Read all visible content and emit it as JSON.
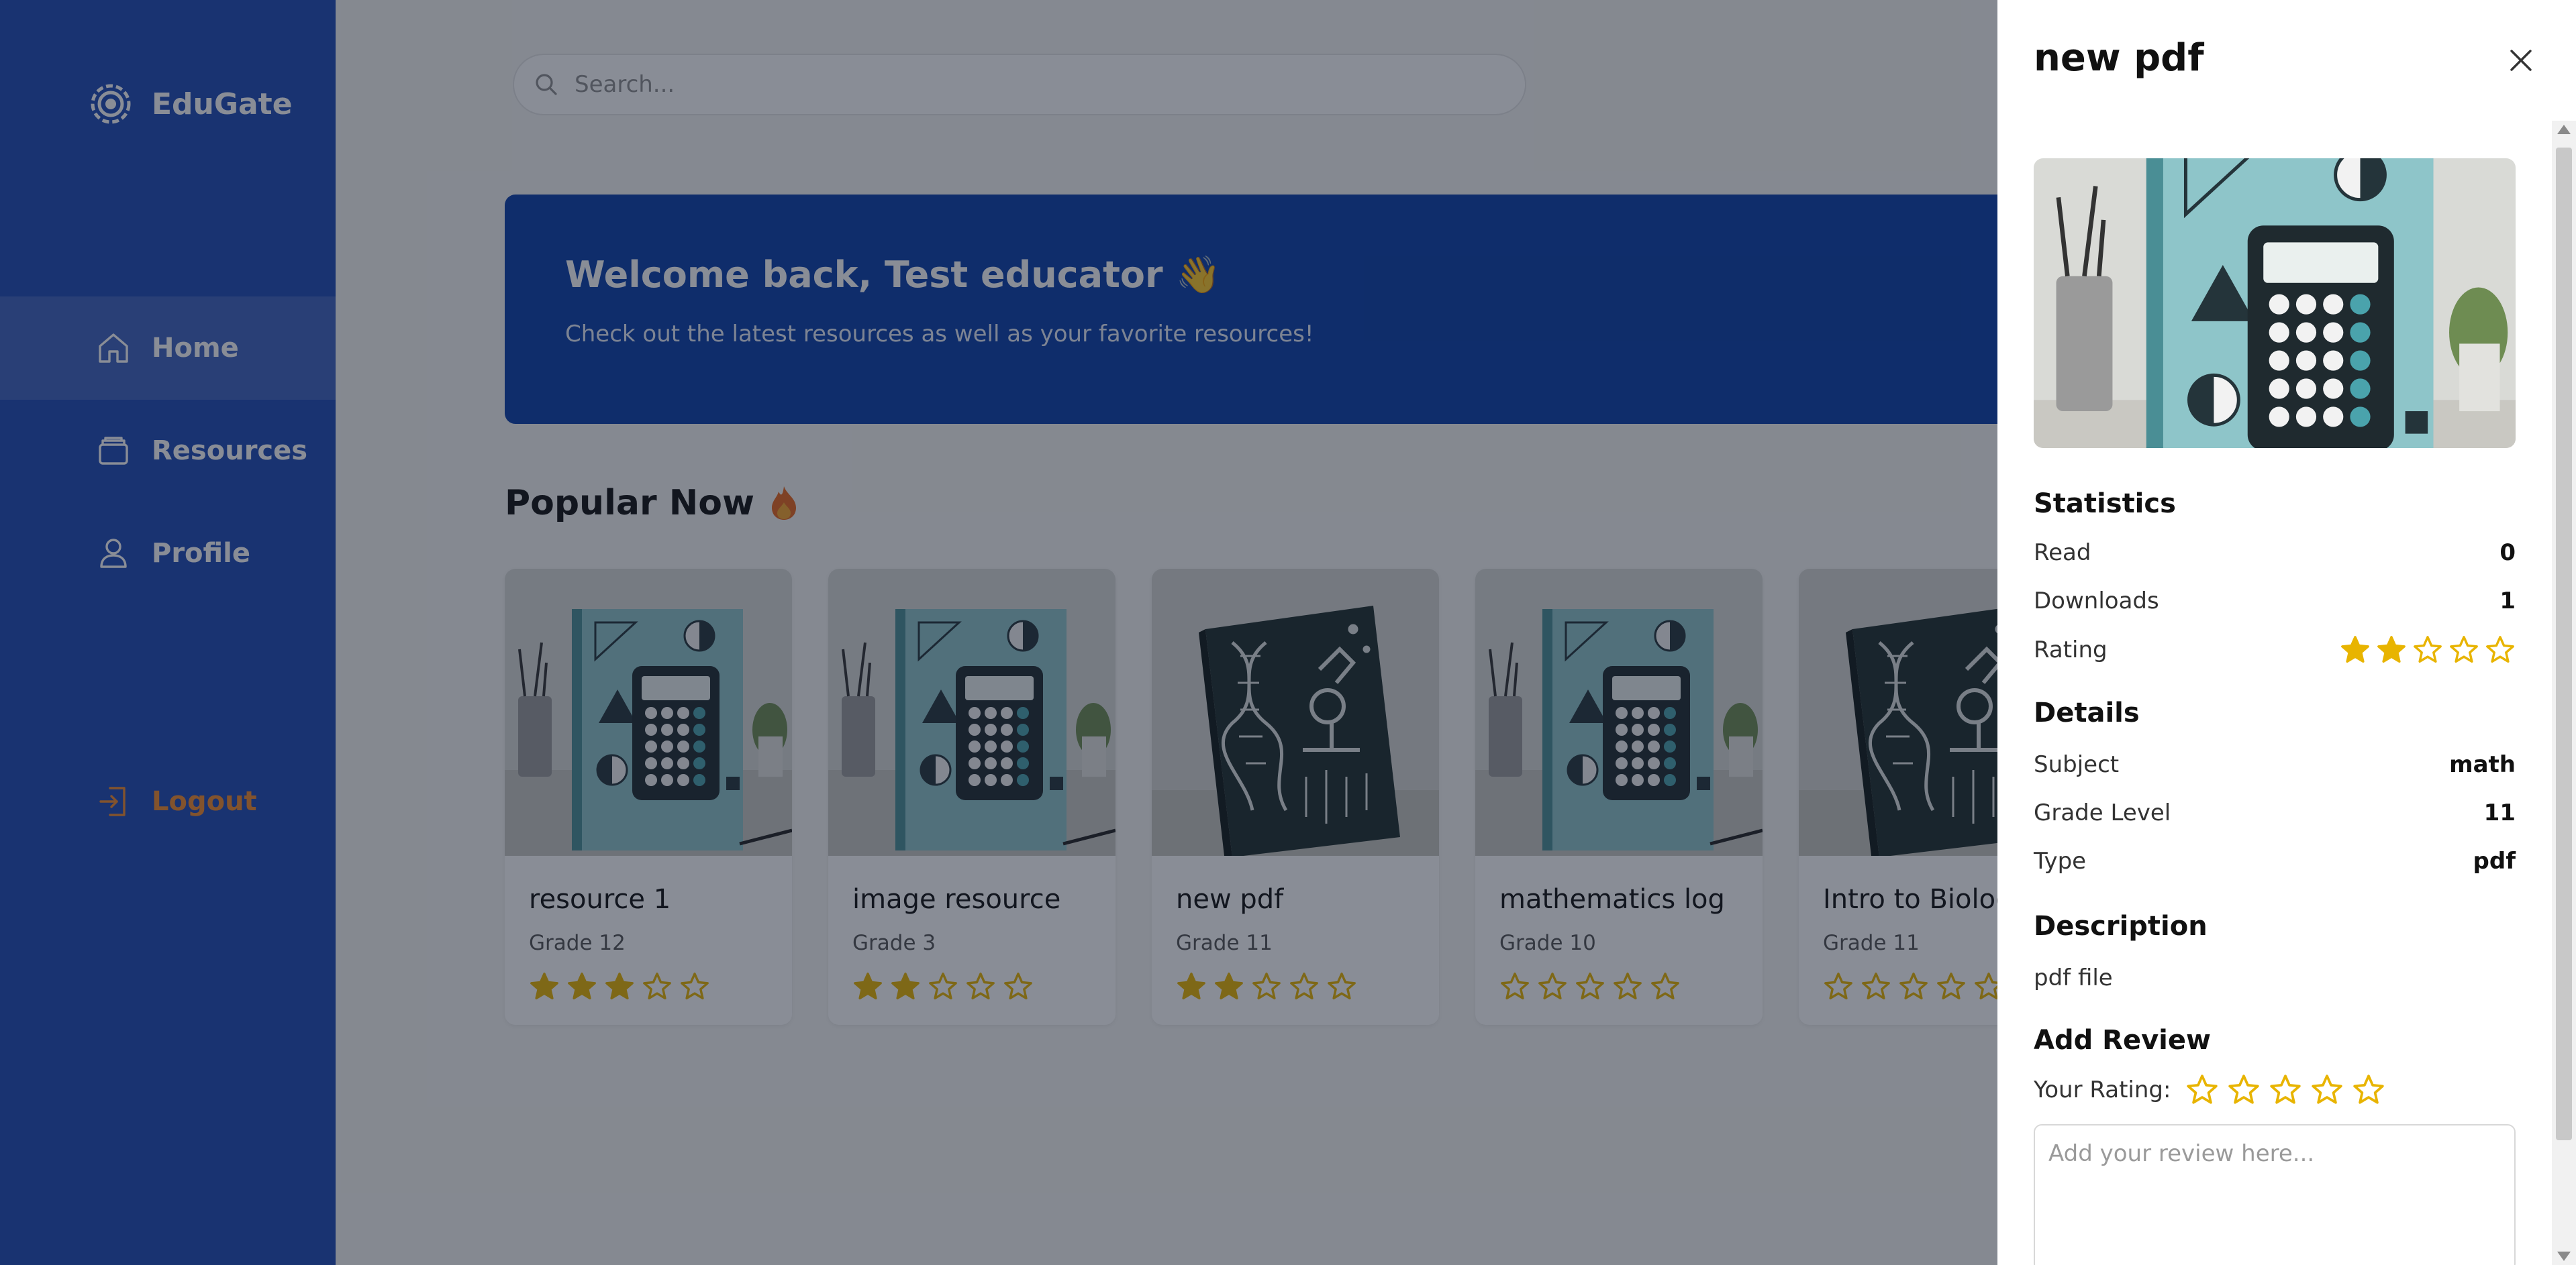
{
  "brand": {
    "name": "EduGate",
    "logo_icon": "gear-logo-icon"
  },
  "sidebar": {
    "items": [
      {
        "label": "Home",
        "icon": "home-icon",
        "active": true
      },
      {
        "label": "Resources",
        "icon": "folder-icon",
        "active": false
      },
      {
        "label": "Profile",
        "icon": "user-icon",
        "active": false
      }
    ],
    "logout_label": "Logout",
    "logout_icon": "logout-icon"
  },
  "search": {
    "placeholder": "Search..."
  },
  "welcome": {
    "title": "Welcome back, Test educator 👋",
    "subtitle": "Check out the latest resources as well as your favorite resources!"
  },
  "popular": {
    "title": "Popular Now",
    "icon": "fire-icon",
    "cards": [
      {
        "title": "resource 1",
        "grade": "Grade 12",
        "rating": 3,
        "cover": "math"
      },
      {
        "title": "image resource",
        "grade": "Grade 3",
        "rating": 2,
        "cover": "math"
      },
      {
        "title": "new pdf",
        "grade": "Grade 11",
        "rating": 2,
        "cover": "biology"
      },
      {
        "title": "mathematics log",
        "grade": "Grade 10",
        "rating": 0,
        "cover": "math"
      },
      {
        "title": "Intro to Biology",
        "grade": "Grade 11",
        "rating": 0,
        "cover": "biology"
      }
    ]
  },
  "drawer": {
    "title": "new pdf",
    "statistics_title": "Statistics",
    "read_label": "Read",
    "read_value": "0",
    "downloads_label": "Downloads",
    "downloads_value": "1",
    "rating_label": "Rating",
    "rating_value": 2,
    "details_title": "Details",
    "subject_label": "Subject",
    "subject_value": "math",
    "grade_label": "Grade Level",
    "grade_value": "11",
    "type_label": "Type",
    "type_value": "pdf",
    "description_title": "Description",
    "description_text": "pdf file",
    "add_review_title": "Add Review",
    "your_rating_label": "Your Rating:",
    "review_placeholder": "Add your review here..."
  },
  "colors": {
    "sidebar": "#1f4ab5",
    "banner": "#0a3ea8",
    "star": "#e8b400",
    "logout": "#f08a2c"
  }
}
